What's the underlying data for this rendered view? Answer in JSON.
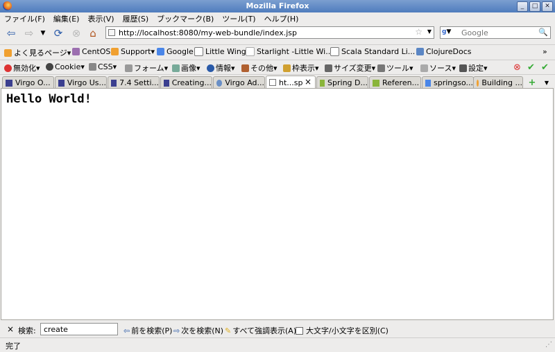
{
  "window": {
    "title": "Mozilla Firefox"
  },
  "menu": [
    "ファイル(F)",
    "編集(E)",
    "表示(V)",
    "履歴(S)",
    "ブックマーク(B)",
    "ツール(T)",
    "ヘルプ(H)"
  ],
  "nav": {
    "url": "http://localhost:8080/my-web-bundle/index.jsp",
    "search_placeholder": "Google"
  },
  "bookmarks": [
    "よく見るページ",
    "CentOS",
    "Support",
    "Google",
    "Little Wings",
    "Starlight -Little Wi...",
    "Scala Standard Li...",
    "ClojureDocs"
  ],
  "webdev": [
    "無効化",
    "Cookie",
    "CSS",
    "フォーム",
    "画像",
    "情報",
    "その他",
    "枠表示",
    "サイズ変更",
    "ツール",
    "ソース",
    "設定"
  ],
  "tabs": [
    "Virgo O...",
    "Virgo Us...",
    "7.4 Setti...",
    "Creating...",
    "Virgo Ad...",
    "ht...sp",
    "Spring D...",
    "Referen...",
    "springso...",
    "Building ..."
  ],
  "content": {
    "heading": "Hello World!"
  },
  "findbar": {
    "label": "検索:",
    "query": "create",
    "prev": "前を検索(P)",
    "next": "次を検索(N)",
    "highlight": "すべて強調表示(A)",
    "match_case": "大文字/小文字を区別(C)"
  },
  "status": {
    "text": "完了"
  },
  "colors": {
    "titlebar": "#5b86c4",
    "background": "#edeceb"
  }
}
